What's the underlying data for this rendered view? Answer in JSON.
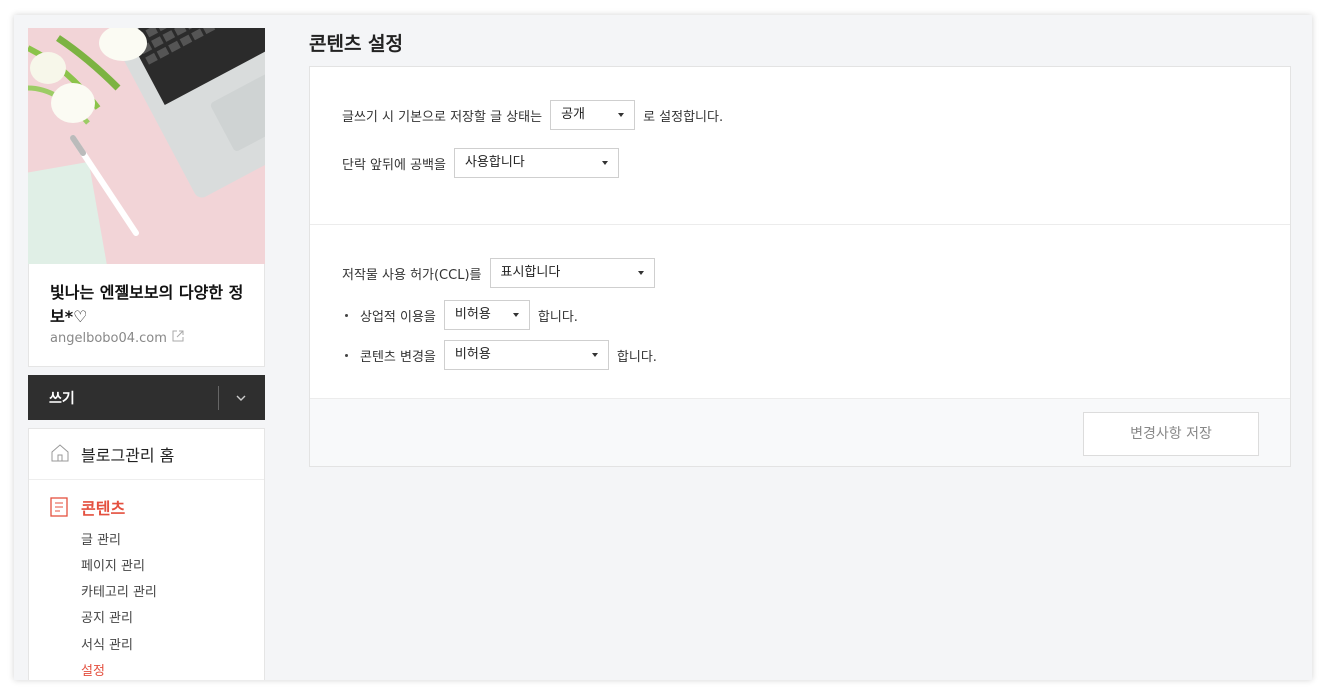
{
  "sidebar": {
    "blog_title": "빛나는 엔젤보보의 다양한 정보*♡",
    "blog_url": "angelbobo04.com",
    "write_label": "쓰기",
    "home_label": "블로그관리 홈",
    "section_label": "콘텐츠",
    "sub_items": [
      "글 관리",
      "페이지 관리",
      "카테고리 관리",
      "공지 관리",
      "서식 관리",
      "설정"
    ]
  },
  "main": {
    "page_title": "콘텐츠 설정",
    "row1": {
      "prefix": "글쓰기 시 기본으로 저장할 글 상태는",
      "selected": "공개",
      "suffix": "로 설정합니다."
    },
    "row2": {
      "prefix": "단락 앞뒤에 공백을",
      "selected": "사용합니다"
    },
    "row3": {
      "prefix": "저작물 사용 허가(CCL)를",
      "selected": "표시합니다"
    },
    "row4": {
      "prefix": "상업적 이용을",
      "selected": "비허용",
      "suffix": "합니다."
    },
    "row5": {
      "prefix": "콘텐츠 변경을",
      "selected": "비허용",
      "suffix": "합니다."
    },
    "save_label": "변경사항 저장"
  },
  "colors": {
    "accent": "#e4503f",
    "dark": "#2f2f2f"
  }
}
